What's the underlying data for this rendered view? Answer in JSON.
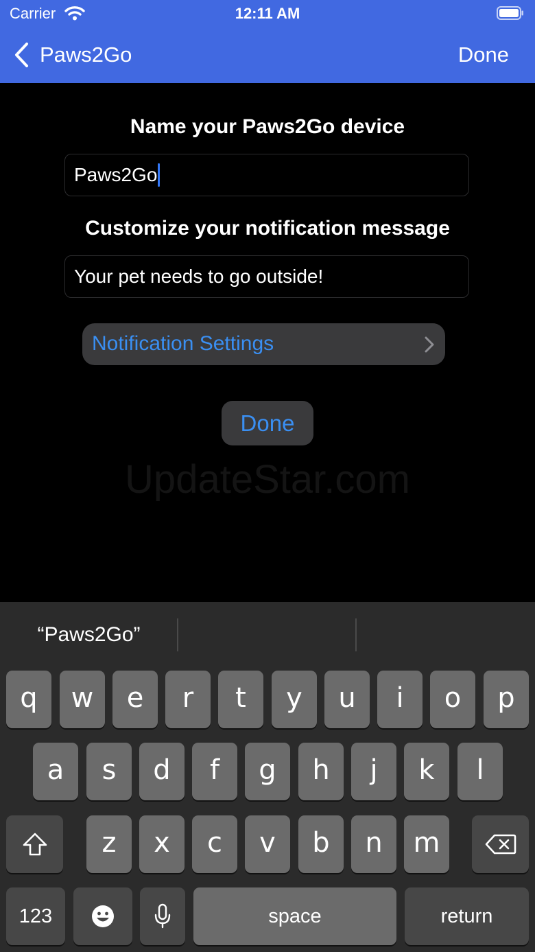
{
  "status_bar": {
    "carrier": "Carrier",
    "time": "12:11 AM",
    "icons": [
      "wifi-icon",
      "battery-icon"
    ]
  },
  "nav": {
    "back_label": "Paws2Go",
    "done_label": "Done",
    "background_color": "#4169e1"
  },
  "form": {
    "device_name_title": "Name your Paws2Go device",
    "device_name_value": "Paws2Go",
    "message_title": "Customize your notification message",
    "message_value": "Your pet needs to go outside!",
    "notification_settings_label": "Notification Settings",
    "done_label": "Done",
    "accent_color": "#3a8ff2"
  },
  "watermark": "UpdateStar.com",
  "keyboard": {
    "suggestions": [
      "“Paws2Go”",
      "",
      ""
    ],
    "row1": [
      "q",
      "w",
      "e",
      "r",
      "t",
      "y",
      "u",
      "i",
      "o",
      "p"
    ],
    "row2": [
      "a",
      "s",
      "d",
      "f",
      "g",
      "h",
      "j",
      "k",
      "l"
    ],
    "row3": [
      "z",
      "x",
      "c",
      "v",
      "b",
      "n",
      "m"
    ],
    "numbers_label": "123",
    "space_label": "space",
    "return_label": "return"
  }
}
